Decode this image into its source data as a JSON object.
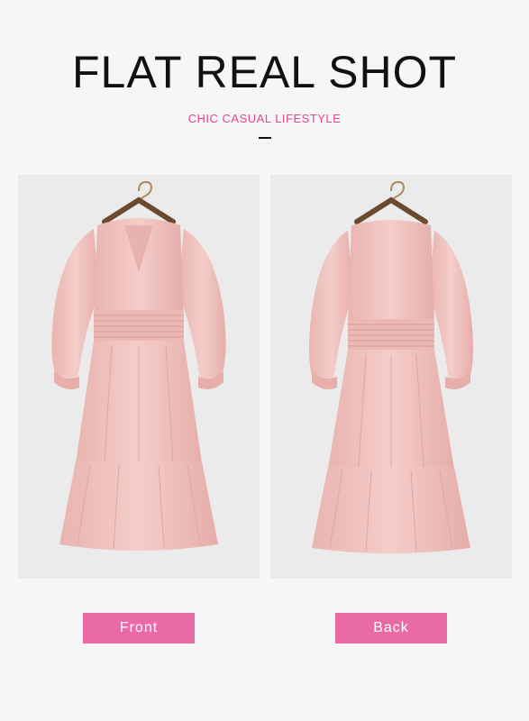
{
  "header": {
    "title": "FLAT REAL SHOT",
    "subtitle": "CHIC CASUAL LIFESTYLE"
  },
  "views": [
    {
      "label": "Front",
      "image": "dress-front-photo"
    },
    {
      "label": "Back",
      "image": "dress-back-photo"
    }
  ],
  "colors": {
    "background": "#f6f6f6",
    "accent_text": "#e0478f",
    "button_fill": "#ea6aa6",
    "dress": "#f1c4c0"
  }
}
